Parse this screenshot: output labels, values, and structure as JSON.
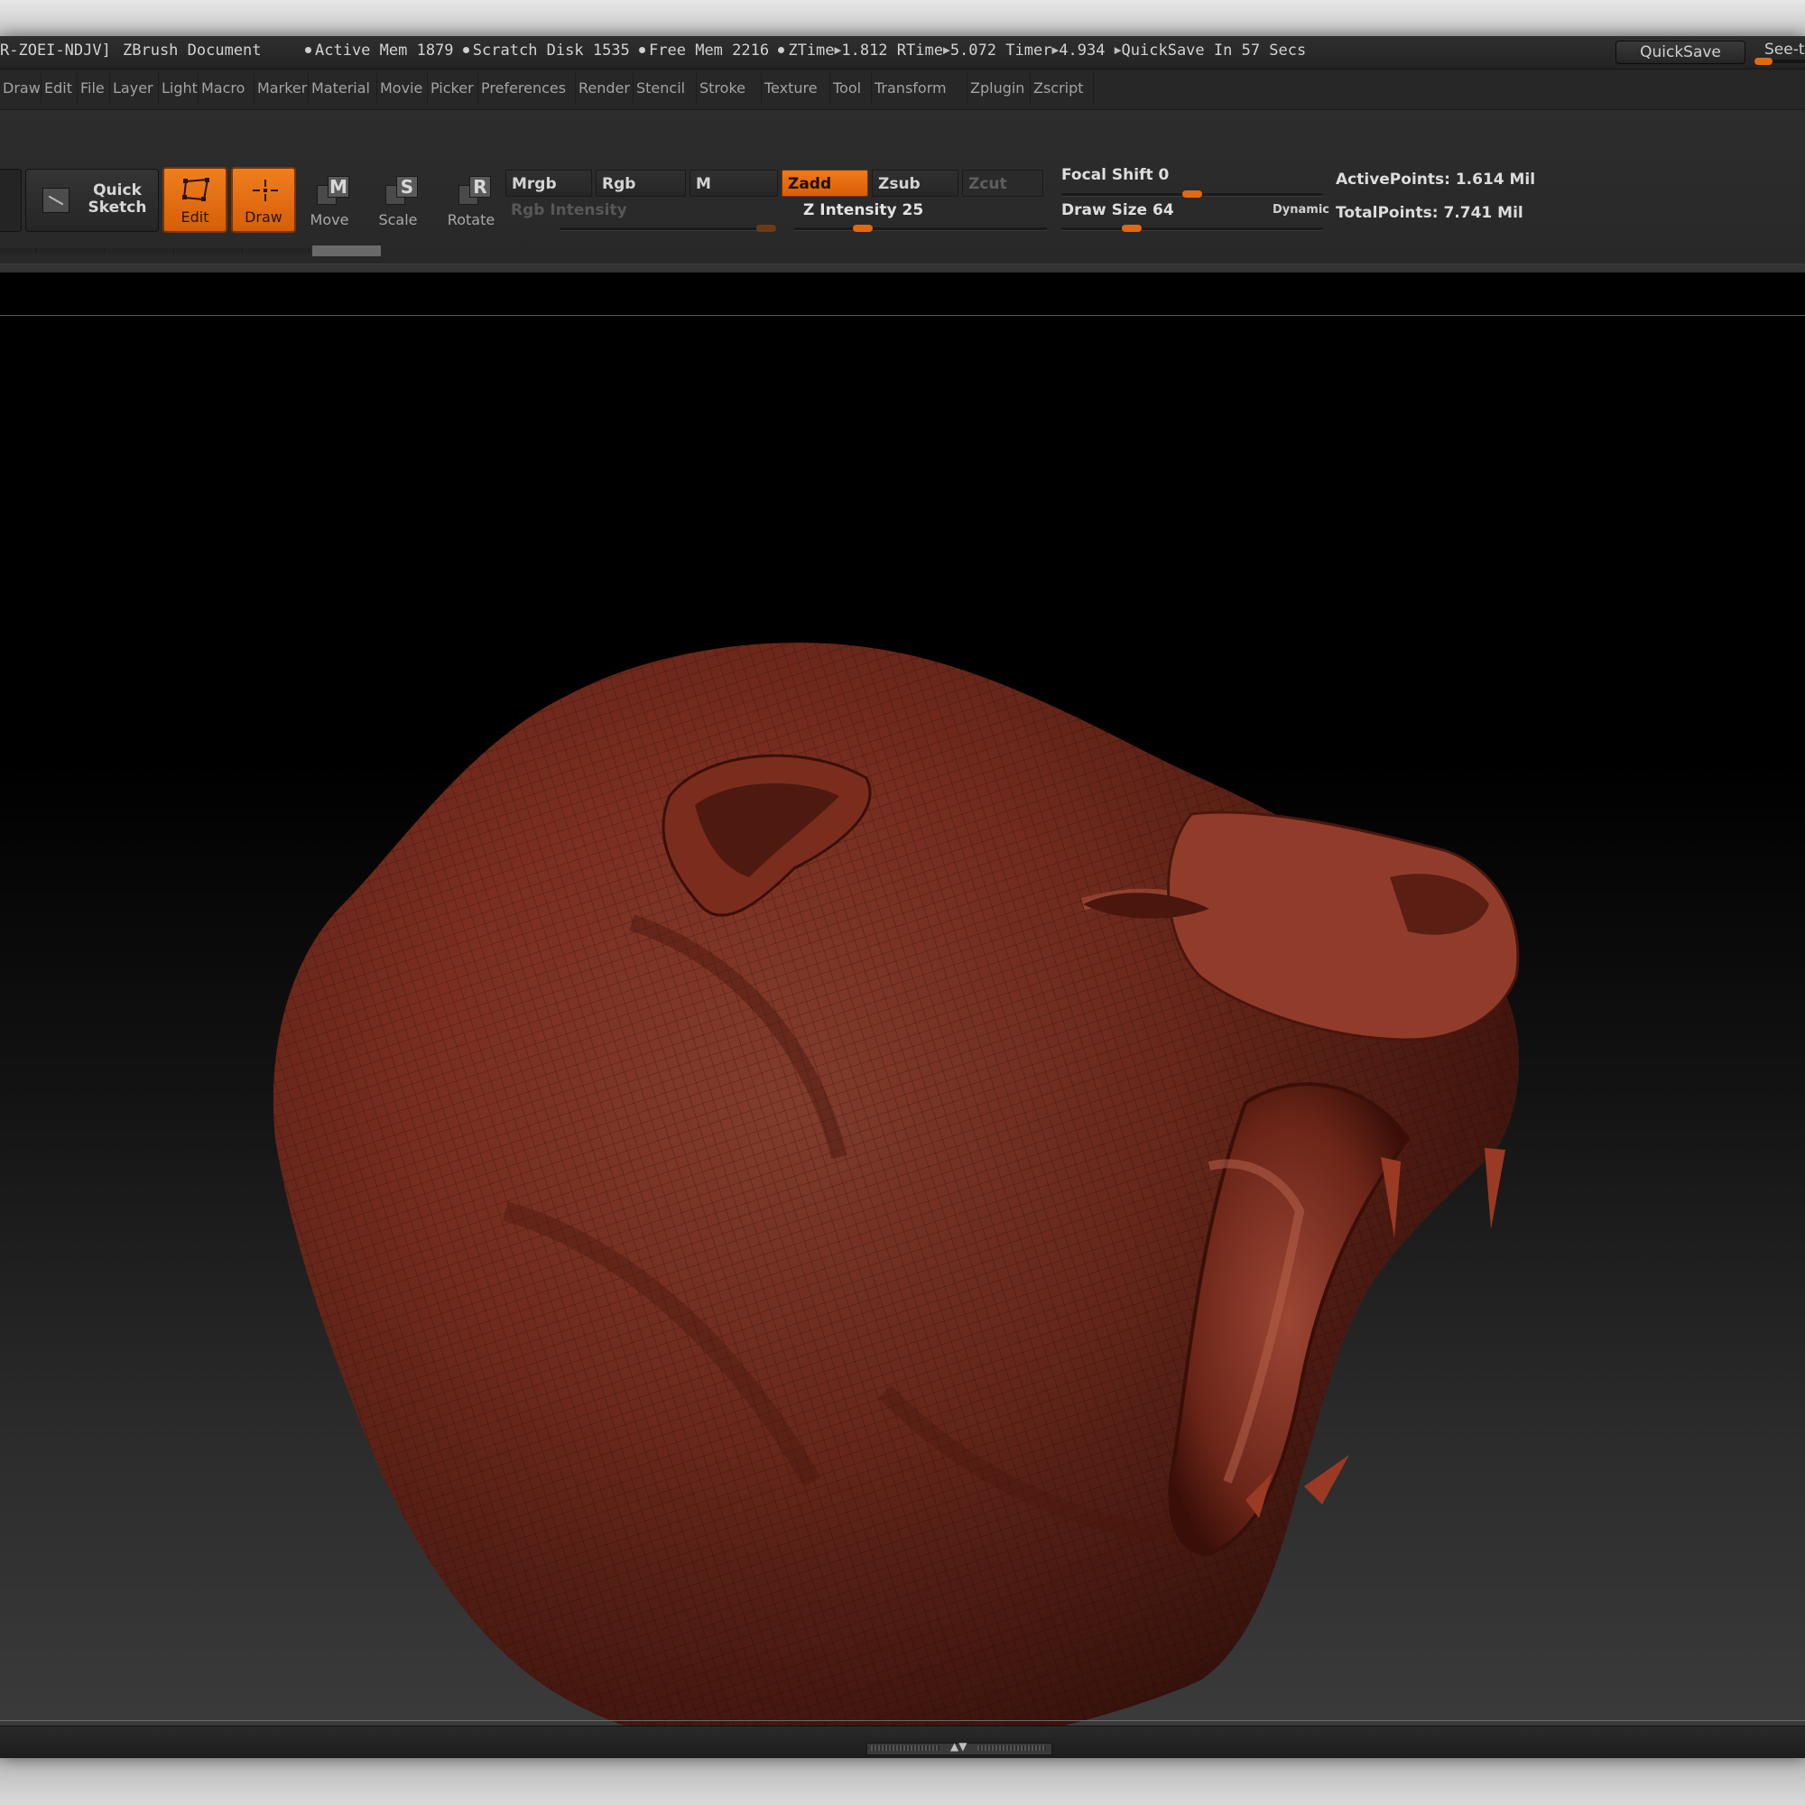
{
  "titlebar": {
    "doc_id": "R-ZOEI-NDJV]",
    "doc_name": "ZBrush Document",
    "active_mem": "Active Mem 1879",
    "scratch_disk": "Scratch Disk 1535",
    "free_mem": "Free Mem 2216",
    "ztime": "ZTime",
    "ztime_val": "1.812",
    "rtime": "RTime",
    "rtime_val": "5.072",
    "timer": "Timer",
    "timer_val": "4.934",
    "quicksave_in": "QuickSave In 57 Secs",
    "quicksave_button": "QuickSave",
    "seethrough_label": "See-t",
    "seethrough_value": 0
  },
  "menu": {
    "items": [
      "Draw",
      "Edit",
      "File",
      "Layer",
      "Light",
      "Macro",
      "Marker",
      "Material",
      "Movie",
      "Picker",
      "Preferences",
      "Render",
      "Stencil",
      "Stroke",
      "Texture",
      "Tool",
      "Transform",
      "Zplugin",
      "Zscript"
    ]
  },
  "shelf": {
    "quick_sketch": "Quick\nSketch",
    "edit": "Edit",
    "draw": "Draw",
    "move": "Move",
    "move_key": "M",
    "scale": "Scale",
    "scale_key": "S",
    "rotate": "Rotate",
    "rotate_key": "R",
    "mrgb": "Mrgb",
    "rgb": "Rgb",
    "m": "M",
    "zadd": "Zadd",
    "zsub": "Zsub",
    "zcut": "Zcut",
    "rgb_intensity": "Rgb Intensity",
    "z_intensity": "Z Intensity 25",
    "focal_shift": "Focal Shift 0",
    "draw_size": "Draw Size 64",
    "dynamic": "Dynamic",
    "active_points": "ActivePoints: 1.614 Mil",
    "total_points": "TotalPoints: 7.741 Mil",
    "sliders": {
      "rgb_intensity": 1.0,
      "z_intensity": 0.25,
      "focal_shift": 0.5,
      "draw_size": 0.25
    }
  },
  "colors": {
    "accent": "#e3690e",
    "clay": "#8a3424",
    "panel": "#2b2b2b"
  }
}
